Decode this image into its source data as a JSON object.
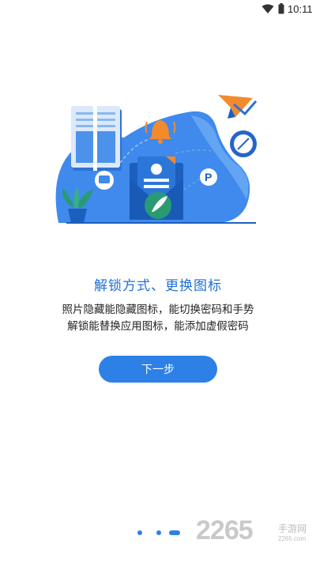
{
  "status_bar": {
    "time": "10:11",
    "wifi_icon": "wifi-icon",
    "battery_icon": "battery-icon"
  },
  "onboarding": {
    "title": "解锁方式、更换图标",
    "description_line1": "照片隐藏能隐藏图标，能切换密码和手势",
    "description_line2": "解锁能替换应用图标，能添加虚假密码",
    "next_button": "下一步",
    "page_indicator": {
      "total": 3,
      "current": 3
    }
  },
  "watermark": {
    "number": "2265",
    "text": "手游网",
    "url": "2265.com"
  },
  "colors": {
    "accent": "#2d80e6",
    "title": "#1f6fd6",
    "illustration_light": "#5b9ff0",
    "orange": "#f28a2e"
  }
}
